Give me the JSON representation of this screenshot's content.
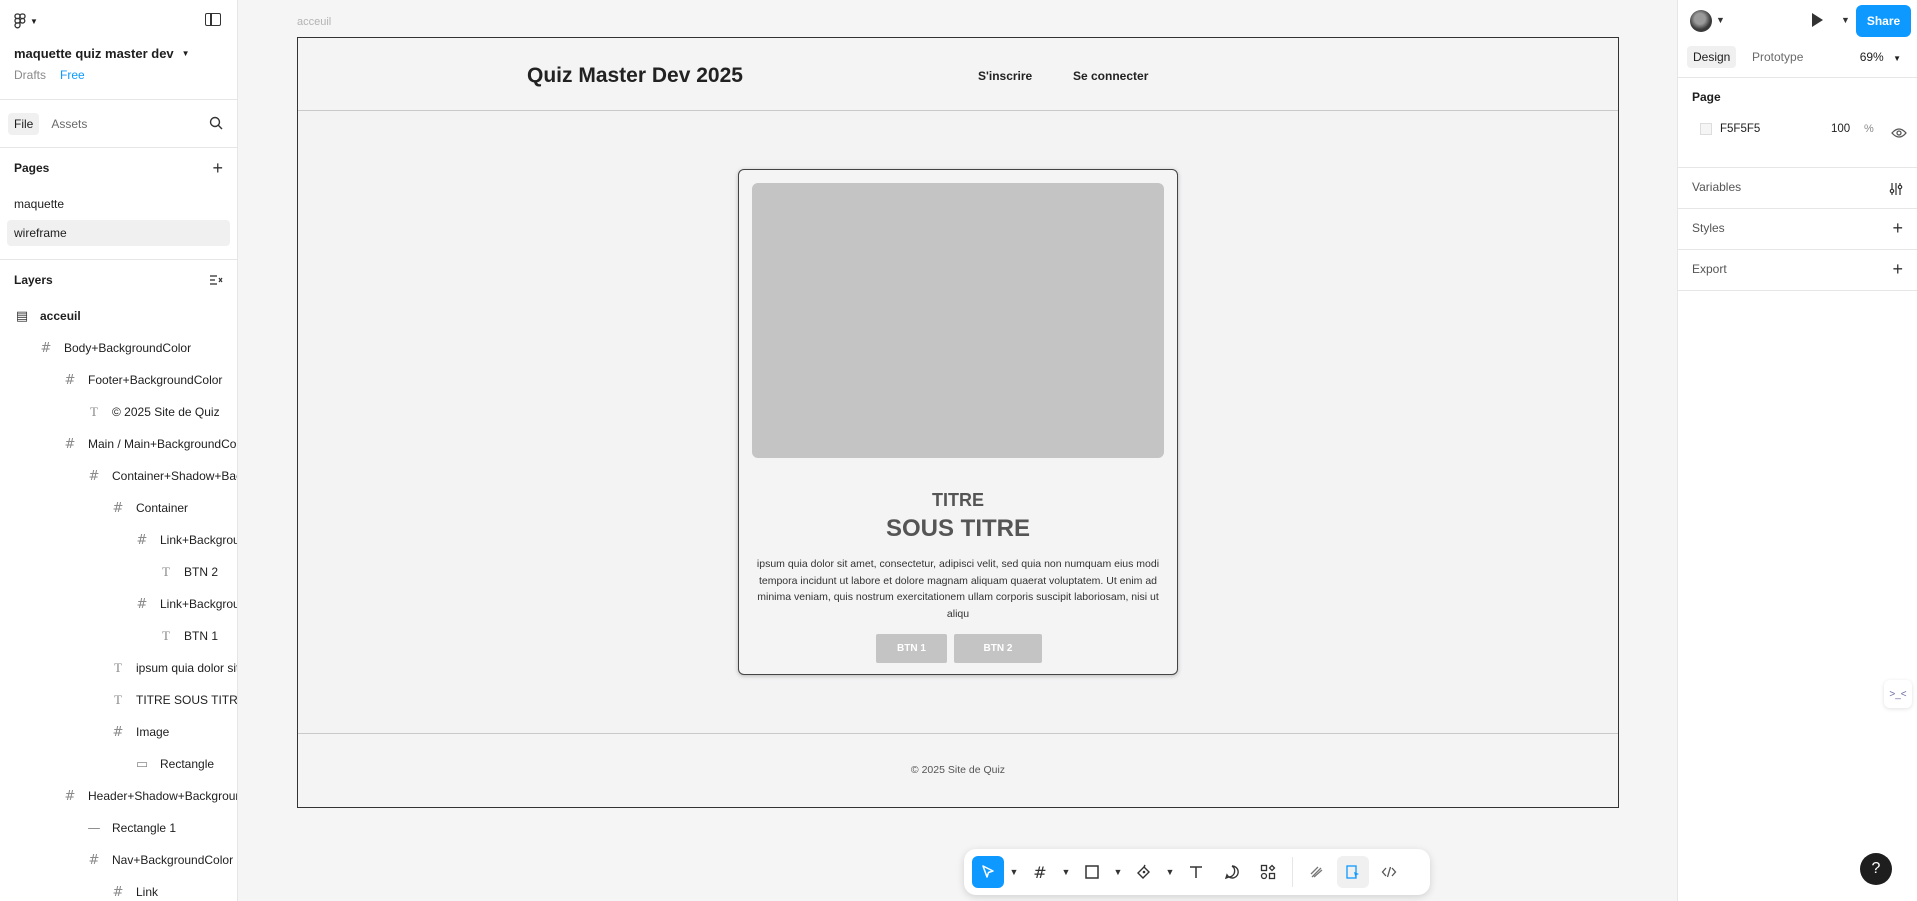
{
  "app": {
    "file_name": "maquette quiz master dev",
    "drafts_label": "Drafts",
    "plan_label": "Free"
  },
  "left_panel": {
    "tabs": [
      {
        "label": "File"
      },
      {
        "label": "Assets"
      }
    ],
    "pages_title": "Pages",
    "pages": [
      {
        "label": "maquette"
      },
      {
        "label": "wireframe"
      }
    ],
    "layers_title": "Layers",
    "layers": [
      {
        "label": "acceuil",
        "type": "section",
        "indent": 0
      },
      {
        "label": "Body+BackgroundColor",
        "type": "frame",
        "indent": 1
      },
      {
        "label": "Footer+BackgroundColor",
        "type": "frame",
        "indent": 2
      },
      {
        "label": "© 2025 Site de Quiz",
        "type": "text",
        "indent": 3
      },
      {
        "label": "Main / Main+BackgroundColor",
        "type": "frame",
        "indent": 2
      },
      {
        "label": "Container+Shadow+BackgroundColor",
        "type": "frame",
        "indent": 3
      },
      {
        "label": "Container",
        "type": "frame",
        "indent": 4
      },
      {
        "label": "Link+BackgroundColor",
        "type": "frame",
        "indent": 5
      },
      {
        "label": "BTN 2",
        "type": "text",
        "indent": 6
      },
      {
        "label": "Link+BackgroundColor",
        "type": "frame",
        "indent": 5
      },
      {
        "label": "BTN 1",
        "type": "text",
        "indent": 6
      },
      {
        "label": "ipsum quia dolor sit amet",
        "type": "text",
        "indent": 4
      },
      {
        "label": "TITRE SOUS TITRE",
        "type": "text",
        "indent": 4
      },
      {
        "label": "Image",
        "type": "frame",
        "indent": 4
      },
      {
        "label": "Rectangle",
        "type": "rect",
        "indent": 5
      },
      {
        "label": "Header+Shadow+BackgroundColor",
        "type": "frame",
        "indent": 2
      },
      {
        "label": "Rectangle 1",
        "type": "line",
        "indent": 3
      },
      {
        "label": "Nav+BackgroundColor",
        "type": "frame",
        "indent": 3
      },
      {
        "label": "Link",
        "type": "frame",
        "indent": 4
      }
    ]
  },
  "canvas": {
    "frame_label": "acceuil",
    "site_title": "Quiz Master Dev 2025",
    "nav_signup": "S'inscrire",
    "nav_login": "Se connecter",
    "card_title": "TITRE",
    "card_subtitle": "SOUS TITRE",
    "card_body": "ipsum quia dolor sit amet, consectetur, adipisci velit, sed quia non numquam eius modi tempora incidunt ut labore et dolore magnam aliquam quaerat voluptatem. Ut enim ad minima veniam, quis nostrum exercitationem ullam corporis suscipit laboriosam, nisi ut aliqu",
    "btn1": "BTN 1",
    "btn2": "BTN 2",
    "footer_text": "© 2025 Site de Quiz"
  },
  "right_panel": {
    "share_label": "Share",
    "tabs": [
      {
        "label": "Design"
      },
      {
        "label": "Prototype"
      }
    ],
    "zoom": "69%",
    "page_section": "Page",
    "page_color_hex": "F5F5F5",
    "page_opacity": "100",
    "percent_sign": "%",
    "variables_label": "Variables",
    "styles_label": "Styles",
    "export_label": "Export"
  },
  "help_label": "?",
  "colors": {
    "accent": "#0d99ff",
    "canvas": "#f5f5f5",
    "placeholder": "#c4c4c4"
  }
}
